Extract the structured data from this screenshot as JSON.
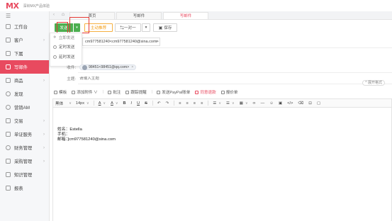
{
  "app": {
    "logo": "MX",
    "company": "深圳MX产品体验"
  },
  "sidebar": {
    "toggle": "☰",
    "items": [
      {
        "label": "工作台",
        "arrow": "",
        "active": false
      },
      {
        "label": "客户",
        "arrow": "›",
        "active": false
      },
      {
        "label": "下属",
        "arrow": "",
        "active": false
      },
      {
        "label": "写邮件",
        "arrow": "",
        "active": true
      },
      {
        "label": "商品",
        "arrow": "›",
        "active": false
      },
      {
        "label": "发现",
        "arrow": "",
        "active": false
      },
      {
        "label": "营销AM",
        "arrow": "",
        "active": false
      },
      {
        "label": "交易",
        "arrow": "›",
        "active": false
      },
      {
        "label": "单证服务",
        "arrow": "›",
        "active": false
      },
      {
        "label": "财务管理",
        "arrow": "›",
        "active": false
      },
      {
        "label": "采购管理",
        "arrow": "›",
        "active": false
      },
      {
        "label": "知识管理",
        "arrow": "",
        "active": false
      },
      {
        "label": "报表",
        "arrow": "",
        "active": false
      }
    ]
  },
  "tabs": {
    "prev": "‹",
    "home_icon": "⌂",
    "items": [
      {
        "label": "首页",
        "active": false
      },
      {
        "label": "写邮件",
        "active": false
      },
      {
        "label": "写邮件",
        "active": true
      }
    ]
  },
  "toolbar": {
    "send": "发送",
    "send_caret": "▾",
    "proactive": "主动推荐",
    "one_to_one": "⇆一对一",
    "one_to_one_caret": "▾",
    "save": "保存"
  },
  "send_menu": {
    "items": [
      {
        "label": "立即发送"
      },
      {
        "label": "定时发送"
      },
      {
        "label": "延时发送"
      }
    ]
  },
  "form": {
    "sender_value": "cm977581240<cm977581240@sina.com>",
    "sender_caret": "▾",
    "recipient_label": "收件:",
    "recipient_chip": "98451<98451@qq.com>",
    "recipient_remove": "×",
    "subject_label": "主题:",
    "subject_placeholder": "请输入主题",
    "extend_label": "^ 展开格式"
  },
  "actions": {
    "items": [
      {
        "label": "模板",
        "red": false
      },
      {
        "label": "添加附件 ∨",
        "red": false
      },
      {
        "label": "批注",
        "red": false
      },
      {
        "label": "跟踪提醒",
        "red": false
      },
      {
        "label": "发送PayPal账单",
        "red": false
      },
      {
        "label": "同意退款",
        "red": true
      },
      {
        "label": "报价单",
        "red": false
      }
    ]
  },
  "editor_toolbar": {
    "font": "黑体",
    "size": "14px",
    "caret": "∨",
    "bold": "B",
    "italic": "I",
    "underline": "U",
    "strike": "S",
    "undo": "↶",
    "redo": "↷",
    "align_left": "≡",
    "align_center": "≡",
    "align_right": "≡",
    "align_justify": "≡",
    "list_bullet": "☰",
    "list_number": "☰",
    "table": "▦",
    "link": "∞",
    "hr": "—",
    "emoji": "☺",
    "image": "▣",
    "code": "</>",
    "clear": "⌫",
    "full": "⊡",
    "preview": "▢"
  },
  "signature": {
    "name_line": "姓名：Estella",
    "phone_line": "手机：",
    "email_line": "邮箱：]cm977581240@sina.com"
  },
  "colors": {
    "brand": "#e84a5f",
    "send_green": "#4caf50",
    "highlight_red": "#e53935"
  }
}
